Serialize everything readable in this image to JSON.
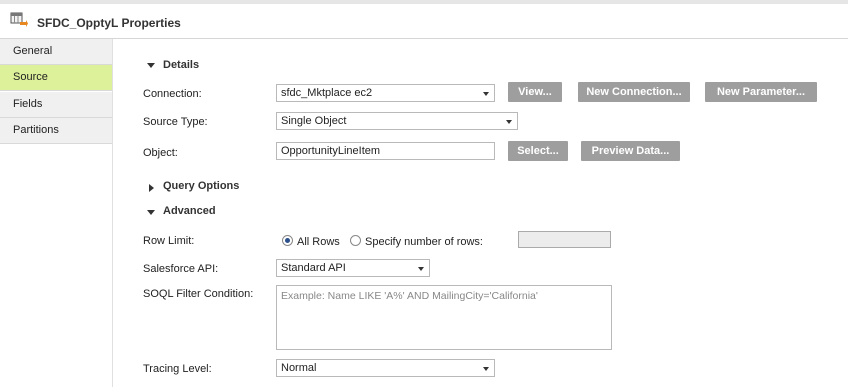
{
  "window": {
    "title": "SFDC_OpptyL Properties",
    "icon": "source-transformation-icon"
  },
  "sidebar": {
    "items": [
      {
        "label": "General",
        "active": false
      },
      {
        "label": "Source",
        "active": true
      },
      {
        "label": "Fields",
        "active": false
      },
      {
        "label": "Partitions",
        "active": false
      }
    ]
  },
  "details": {
    "heading": "Details",
    "connection": {
      "label": "Connection:",
      "value": "sfdc_Mktplace ec2",
      "view_button": "View...",
      "new_connection_button": "New Connection...",
      "new_parameter_button": "New Parameter..."
    },
    "source_type": {
      "label": "Source Type:",
      "value": "Single Object"
    },
    "object": {
      "label": "Object:",
      "value": "OpportunityLineItem",
      "select_button": "Select...",
      "preview_button": "Preview Data..."
    }
  },
  "query_options": {
    "heading": "Query Options"
  },
  "advanced": {
    "heading": "Advanced",
    "row_limit": {
      "label": "Row Limit:",
      "option_all": "All Rows",
      "option_specify": "Specify number of rows:",
      "selected": "All Rows",
      "count_value": ""
    },
    "salesforce_api": {
      "label": "Salesforce API:",
      "value": "Standard API"
    },
    "soql_filter": {
      "label": "SOQL Filter Condition:",
      "placeholder": "Example: Name LIKE 'A%' AND MailingCity='California'",
      "value": ""
    },
    "tracing_level": {
      "label": "Tracing Level:",
      "value": "Normal"
    }
  },
  "colors": {
    "active_tab": "#ddf09a",
    "button_bg": "#9e9e9e",
    "button_text": "#ffffff",
    "tab_bg": "#f0f0f0"
  }
}
